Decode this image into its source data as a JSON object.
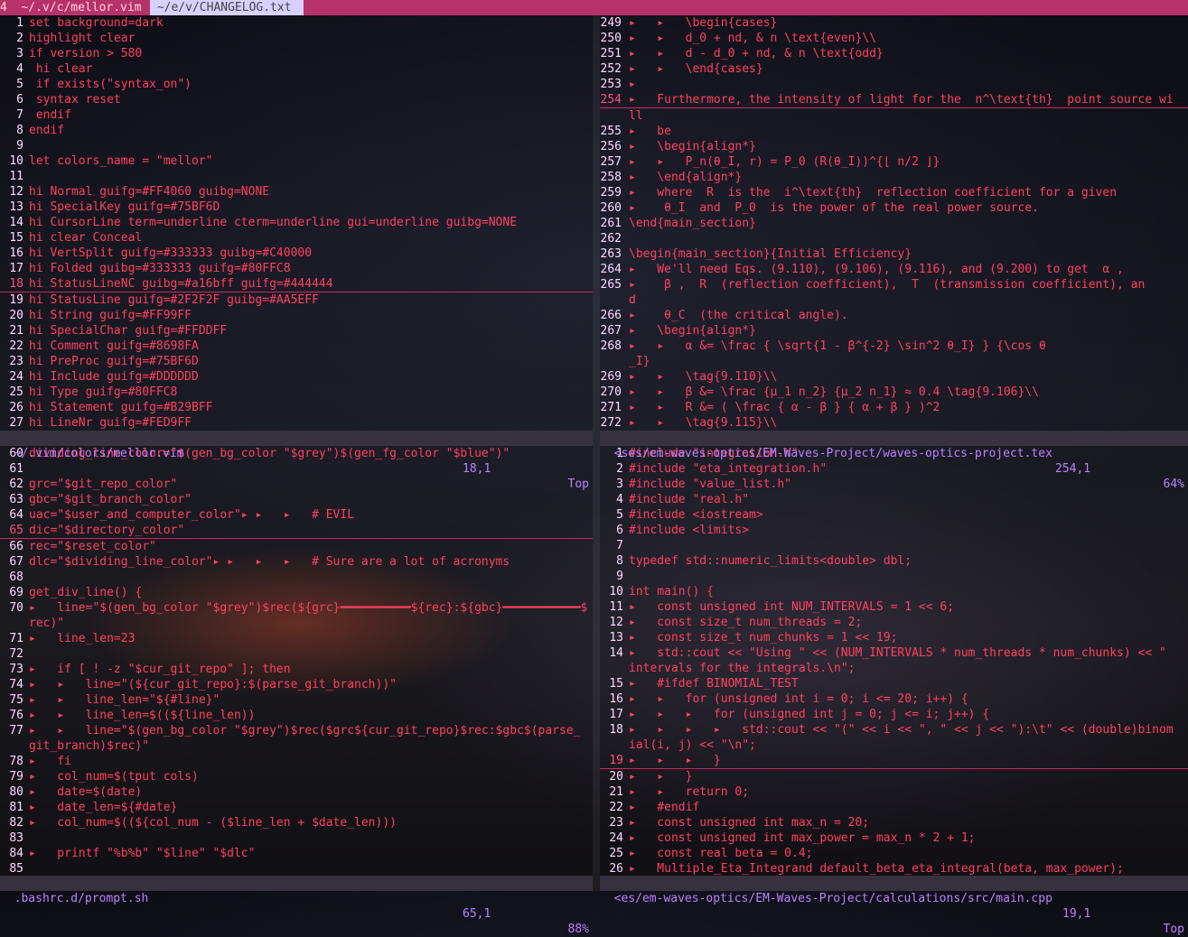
{
  "tabs": {
    "tab1": "4  ~/.v/c/mellor.vim ",
    "tab2": " ~/e/v/CHANGELOG.txt "
  },
  "panes": {
    "top_left": {
      "lines": [
        {
          "n": "1",
          "t": "set background=dark"
        },
        {
          "n": "2",
          "t": "highlight clear"
        },
        {
          "n": "3",
          "t": "if version > 580"
        },
        {
          "n": "4",
          "t": " hi clear"
        },
        {
          "n": "5",
          "t": " if exists(\"syntax_on\")"
        },
        {
          "n": "6",
          "t": " syntax reset"
        },
        {
          "n": "7",
          "t": " endif"
        },
        {
          "n": "8",
          "t": "endif"
        },
        {
          "n": "9",
          "t": ""
        },
        {
          "n": "10",
          "t": "let colors_name = \"mellor\""
        },
        {
          "n": "11",
          "t": ""
        },
        {
          "n": "12",
          "t": "hi Normal guifg=#FF4060 guibg=NONE"
        },
        {
          "n": "13",
          "t": "hi SpecialKey guifg=#75BF6D"
        },
        {
          "n": "14",
          "t": "hi CursorLine term=underline cterm=underline gui=underline guibg=NONE"
        },
        {
          "n": "15",
          "t": "hi clear Conceal"
        },
        {
          "n": "16",
          "t": "hi VertSplit guifg=#333333 guibg=#C40000"
        },
        {
          "n": "17",
          "t": "hi Folded guibg=#333333 guifg=#80FFC8"
        },
        {
          "n": "18",
          "t": "hi StatusLineNC guibg=#a16bff guifg=#444444",
          "cursor": true
        },
        {
          "n": "19",
          "t": "hi StatusLine guifg=#2F2F2F guibg=#AA5EFF"
        },
        {
          "n": "20",
          "t": "hi String guifg=#FF99FF"
        },
        {
          "n": "21",
          "t": "hi SpecialChar guifg=#FFDDFF"
        },
        {
          "n": "22",
          "t": "hi Comment guifg=#8698FA"
        },
        {
          "n": "23",
          "t": "hi PreProc guifg=#75BF6D"
        },
        {
          "n": "24",
          "t": "hi Include guifg=#DDDDDD"
        },
        {
          "n": "25",
          "t": "hi Type guifg=#80FFC8"
        },
        {
          "n": "26",
          "t": "hi Statement guifg=#B29BFF"
        },
        {
          "n": "27",
          "t": "hi LineNr guifg=#FED9FF"
        }
      ],
      "status": {
        "file": "~/.vim/colors/mellor.vim",
        "pos": "18,1",
        "pct": "Top"
      }
    },
    "top_right": {
      "lines": [
        {
          "n": "249",
          "t": "▸   ▸   \\begin{cases}"
        },
        {
          "n": "250",
          "t": "▸   ▸   d_0 + nd, & n \\text{even}\\\\"
        },
        {
          "n": "251",
          "t": "▸   ▸   d - d_0 + nd, & n \\text{odd}"
        },
        {
          "n": "252",
          "t": "▸   ▸   \\end{cases}"
        },
        {
          "n": "253",
          "t": "▸"
        },
        {
          "n": "254",
          "t": "▸   Furthermore, the intensity of light for the  n^\\text{th}  point source wi",
          "cursor": true
        },
        {
          "n": "",
          "t": "ll"
        },
        {
          "n": "255",
          "t": "▸   be"
        },
        {
          "n": "256",
          "t": "▸   \\begin{align*}"
        },
        {
          "n": "257",
          "t": "▸   ▸   P_n(θ_I, r) = P_0 (R(θ_I))^{⌊ n/2 ⌋}"
        },
        {
          "n": "258",
          "t": "▸   \\end{align*}"
        },
        {
          "n": "259",
          "t": "▸   where  R  is the  i^\\text{th}  reflection coefficient for a given"
        },
        {
          "n": "260",
          "t": "▸    θ_I  and  P_0  is the power of the real power source."
        },
        {
          "n": "261",
          "t": "\\end{main_section}"
        },
        {
          "n": "262",
          "t": ""
        },
        {
          "n": "263",
          "t": "\\begin{main_section}{Initial Efficiency}"
        },
        {
          "n": "264",
          "t": "▸   We'll need Eqs. (9.110), (9.106), (9.116), and (9.200) to get  α ,"
        },
        {
          "n": "265",
          "t": "▸    β ,  R  (reflection coefficient),  T  (transmission coefficient), an"
        },
        {
          "n": "",
          "t": "d"
        },
        {
          "n": "266",
          "t": "▸    θ_C  (the critical angle)."
        },
        {
          "n": "267",
          "t": "▸   \\begin{align*}"
        },
        {
          "n": "268",
          "t": "▸   ▸   α &= \\frac { \\sqrt{1 - β^{-2} \\sin^2 θ_I} } {\\cos θ"
        },
        {
          "n": "",
          "t": "_I}"
        },
        {
          "n": "269",
          "t": "▸   ▸   \\tag{9.110}\\\\"
        },
        {
          "n": "270",
          "t": "▸   ▸   β &= \\frac {μ_1 n_2} {μ_2 n_1} ≈ 0.4 \\tag{9.106}\\\\"
        },
        {
          "n": "271",
          "t": "▸   ▸   R &= ( \\frac { α - β } { α + β } )^2"
        },
        {
          "n": "272",
          "t": "▸   ▸   \\tag{9.115}\\\\"
        }
      ],
      "status": {
        "file": "<ses/em-waves-optics/EM-Waves-Project/waves-optics-project.tex",
        "pos": "254,1",
        "pct": "64%"
      }
    },
    "bottom_left": {
      "lines": [
        {
          "n": "60",
          "t": "dividing_line_color=\"$(gen_bg_color \"$grey\")$(gen_fg_color \"$blue\")\""
        },
        {
          "n": "61",
          "t": ""
        },
        {
          "n": "62",
          "t": "grc=\"$git_repo_color\""
        },
        {
          "n": "63",
          "t": "gbc=\"$git_branch_color\""
        },
        {
          "n": "64",
          "t": "uac=\"$user_and_computer_color\"▸ ▸   ▸   # EVIL"
        },
        {
          "n": "65",
          "t": "dic=\"$directory_color\"",
          "cursor": true
        },
        {
          "n": "66",
          "t": "rec=\"$reset_color\""
        },
        {
          "n": "67",
          "t": "dlc=\"$dividing_line_color\"▸ ▸   ▸   ▸   # Sure are a lot of acronyms"
        },
        {
          "n": "68",
          "t": ""
        },
        {
          "n": "69",
          "t": "get_div_line() {"
        },
        {
          "n": "70",
          "t": "▸   line=\"$(gen_bg_color \"$grey\")$rec(${grc}━━━━━━━━━━${rec}:${gbc}━━━━━━━━━━━$"
        },
        {
          "n": "",
          "t": "rec)\""
        },
        {
          "n": "71",
          "t": "▸   line_len=23"
        },
        {
          "n": "72",
          "t": ""
        },
        {
          "n": "73",
          "t": "▸   if [ ! -z \"$cur_git_repo\" ]; then"
        },
        {
          "n": "74",
          "t": "▸   ▸   line=\"(${cur_git_repo}:$(parse_git_branch))\""
        },
        {
          "n": "75",
          "t": "▸   ▸   line_len=\"${#line}\""
        },
        {
          "n": "76",
          "t": "▸   ▸   line_len=$((${line_len))"
        },
        {
          "n": "77",
          "t": "▸   ▸   line=\"$(gen_bg_color \"$grey\")$rec($grc${cur_git_repo}$rec:$gbc$(parse_"
        },
        {
          "n": "",
          "t": "git_branch)$rec)\""
        },
        {
          "n": "78",
          "t": "▸   fi"
        },
        {
          "n": "79",
          "t": "▸   col_num=$(tput cols)"
        },
        {
          "n": "80",
          "t": "▸   date=$(date)"
        },
        {
          "n": "81",
          "t": "▸   date_len=${#date}"
        },
        {
          "n": "82",
          "t": "▸   col_num=$((${col_num - ($line_len + $date_len)))"
        },
        {
          "n": "83",
          "t": ""
        },
        {
          "n": "84",
          "t": "▸   printf \"%b%b\" \"$line\" \"$dlc\""
        },
        {
          "n": "85",
          "t": ""
        }
      ],
      "status": {
        "file": ".bashrc.d/prompt.sh",
        "pos": "65,1",
        "pct": "88%"
      }
    },
    "bottom_right": {
      "lines": [
        {
          "n": "1",
          "t": "#include \"integration.h\""
        },
        {
          "n": "2",
          "t": "#include \"eta_integration.h\""
        },
        {
          "n": "3",
          "t": "#include \"value_list.h\""
        },
        {
          "n": "4",
          "t": "#include \"real.h\""
        },
        {
          "n": "5",
          "t": "#include <iostream>"
        },
        {
          "n": "6",
          "t": "#include <limits>"
        },
        {
          "n": "7",
          "t": ""
        },
        {
          "n": "8",
          "t": "typedef std::numeric_limits<double> dbl;"
        },
        {
          "n": "9",
          "t": ""
        },
        {
          "n": "10",
          "t": "int main() {"
        },
        {
          "n": "11",
          "t": "▸   const unsigned int NUM_INTERVALS = 1 << 6;"
        },
        {
          "n": "12",
          "t": "▸   const size_t num_threads = 2;"
        },
        {
          "n": "13",
          "t": "▸   const size_t num_chunks = 1 << 19;"
        },
        {
          "n": "14",
          "t": "▸   std::cout << \"Using \" << (NUM_INTERVALS * num_threads * num_chunks) << \""
        },
        {
          "n": "",
          "t": "intervals for the integrals.\\n\";"
        },
        {
          "n": "15",
          "t": "▸   #ifdef BINOMIAL_TEST"
        },
        {
          "n": "16",
          "t": "▸   ▸   for (unsigned int i = 0; i <= 20; i++) {"
        },
        {
          "n": "17",
          "t": "▸   ▸   ▸   for (unsigned int j = 0; j <= i; j++) {"
        },
        {
          "n": "18",
          "t": "▸   ▸   ▸   ▸   std::cout << \"(\" << i << \", \" << j << \"):\\t\" << (double)binom"
        },
        {
          "n": "",
          "t": "ial(i, j) << \"\\n\";"
        },
        {
          "n": "19",
          "t": "▸   ▸   ▸   }",
          "cursor": true
        },
        {
          "n": "20",
          "t": "▸   ▸   }"
        },
        {
          "n": "21",
          "t": "▸   ▸   return 0;"
        },
        {
          "n": "22",
          "t": "▸   #endif"
        },
        {
          "n": "23",
          "t": "▸   const unsigned int max_n = 20;"
        },
        {
          "n": "24",
          "t": "▸   const unsigned int max_power = max_n * 2 + 1;"
        },
        {
          "n": "25",
          "t": "▸   const real beta = 0.4;"
        },
        {
          "n": "26",
          "t": "▸   Multiple_Eta_Integrand default_beta_eta_integral(beta, max_power);"
        }
      ],
      "status": {
        "file": "<es/em-waves-optics/EM-Waves-Project/calculations/src/main.cpp",
        "pos": "19,1",
        "pct": "Top"
      }
    }
  }
}
